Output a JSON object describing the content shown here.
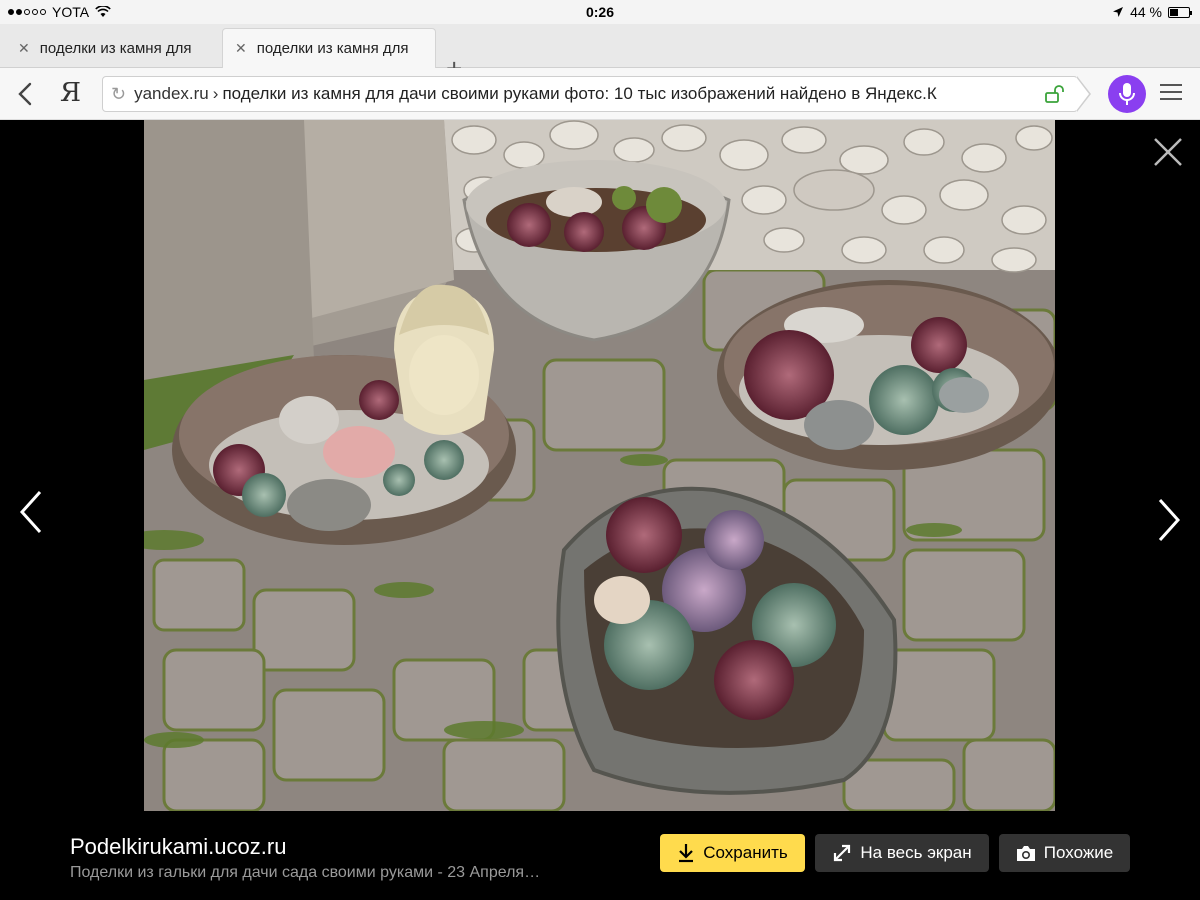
{
  "status_bar": {
    "carrier": "YOTA",
    "time": "0:26",
    "battery_percent": "44 %",
    "battery_level": 0.44
  },
  "tabs": [
    {
      "title": "поделки из камня для",
      "active": false
    },
    {
      "title": "поделки из камня для",
      "active": true
    }
  ],
  "address_bar": {
    "browser_logo": "Я",
    "domain": "yandex.ru",
    "separator": "›",
    "query": "поделки из камня для дачи своими руками фото: 10 тыс изображений найдено в Яндекс.К"
  },
  "viewer": {
    "image_description_icon": "garden-succulent-planters-photo",
    "source_site": "Podelkirukami.ucoz.ru",
    "source_description": "Поделки из гальки для дачи сада своими руками - 23 Апреля…",
    "buttons": {
      "save": "Сохранить",
      "fullscreen": "На весь экран",
      "similar": "Похожие"
    }
  },
  "colors": {
    "accent_yellow": "#ffdb4d",
    "alice_purple": "#8a3ff0",
    "dark_button": "#333333"
  }
}
